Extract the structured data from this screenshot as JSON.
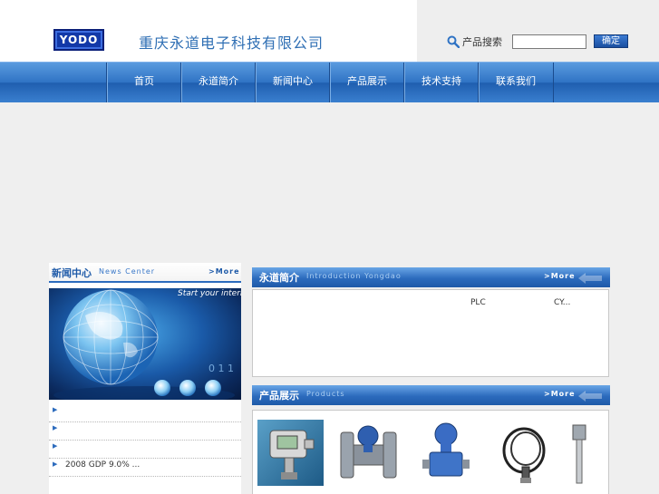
{
  "header": {
    "logo_text": "YODO",
    "company_name": "重庆永道电子科技有限公司",
    "search": {
      "label": "产品搜索",
      "input_value": "",
      "button_label": "确定"
    }
  },
  "nav": {
    "items": [
      {
        "label": "首页"
      },
      {
        "label": "永道简介"
      },
      {
        "label": "新闻中心"
      },
      {
        "label": "产品展示"
      },
      {
        "label": "技术支持"
      },
      {
        "label": "联系我们"
      }
    ]
  },
  "news": {
    "title_cn": "新闻中心",
    "title_en": "News Center",
    "more": ">More",
    "banner_text": "Start your internet",
    "banner_digits": "0 1 1",
    "items": [
      {
        "text": ""
      },
      {
        "text": ""
      },
      {
        "text": ""
      },
      {
        "text": "2008 GDP   9.0%  ..."
      }
    ]
  },
  "intro": {
    "title_cn": "永道简介",
    "title_en": "Introduction Yongdao",
    "more": ">More",
    "text_1": "PLC",
    "text_2": "CY..."
  },
  "products": {
    "title_cn": "产品展示",
    "title_en": "Products",
    "more": ">More",
    "items": [
      {
        "icon": "pressure-transmitter-icon"
      },
      {
        "icon": "flange-transmitter-icon"
      },
      {
        "icon": "differential-transmitter-icon"
      },
      {
        "icon": "cable-sensor-icon"
      },
      {
        "icon": "rod-sensor-icon"
      }
    ]
  },
  "colors": {
    "nav_blue": "#2f73c4",
    "company_blue": "#2f6fb4",
    "background": "#efefef"
  }
}
